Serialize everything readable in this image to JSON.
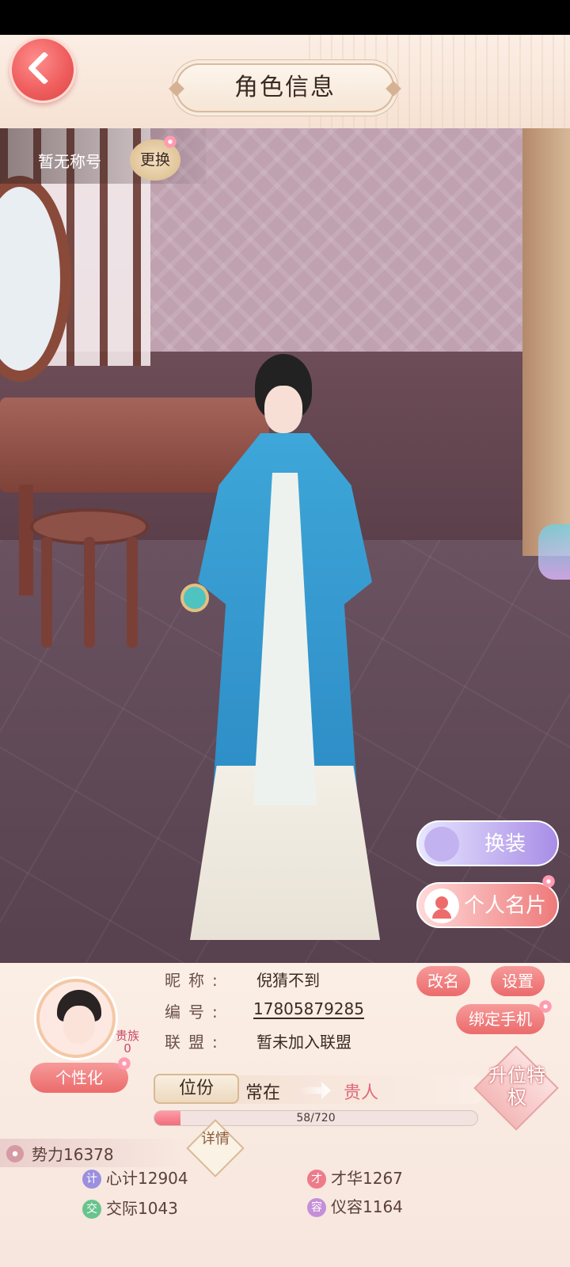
{
  "header": {
    "title": "角色信息"
  },
  "scene": {
    "title_text": "暂无称号",
    "change_label": "更换"
  },
  "side_buttons": {
    "outfit": "换装",
    "card": "个人名片"
  },
  "profile": {
    "noble_label": "贵族",
    "noble_level": "0",
    "personalize": "个性化",
    "nickname_label": "昵称:",
    "nickname": "倪猜不到",
    "id_label": "编号:",
    "id": "17805879285",
    "alliance_label": "联盟:",
    "alliance": "暂未加入联盟",
    "rename": "改名",
    "settings": "设置",
    "bind_phone": "绑定手机"
  },
  "rank": {
    "tag": "位份",
    "current": "常在",
    "next": "贵人",
    "progress_text": "58/720",
    "progress": 0.0806,
    "privilege": "升位特权"
  },
  "stats": {
    "power": "势力16378",
    "detail": "详情",
    "items": [
      {
        "icon": "计",
        "text": "心计12904",
        "color": "#9b8fe0"
      },
      {
        "icon": "才",
        "text": "才华1267",
        "color": "#ee7b8a"
      },
      {
        "icon": "交",
        "text": "交际1043",
        "color": "#68c48c"
      },
      {
        "icon": "容",
        "text": "仪容1164",
        "color": "#c58fd8"
      }
    ]
  }
}
